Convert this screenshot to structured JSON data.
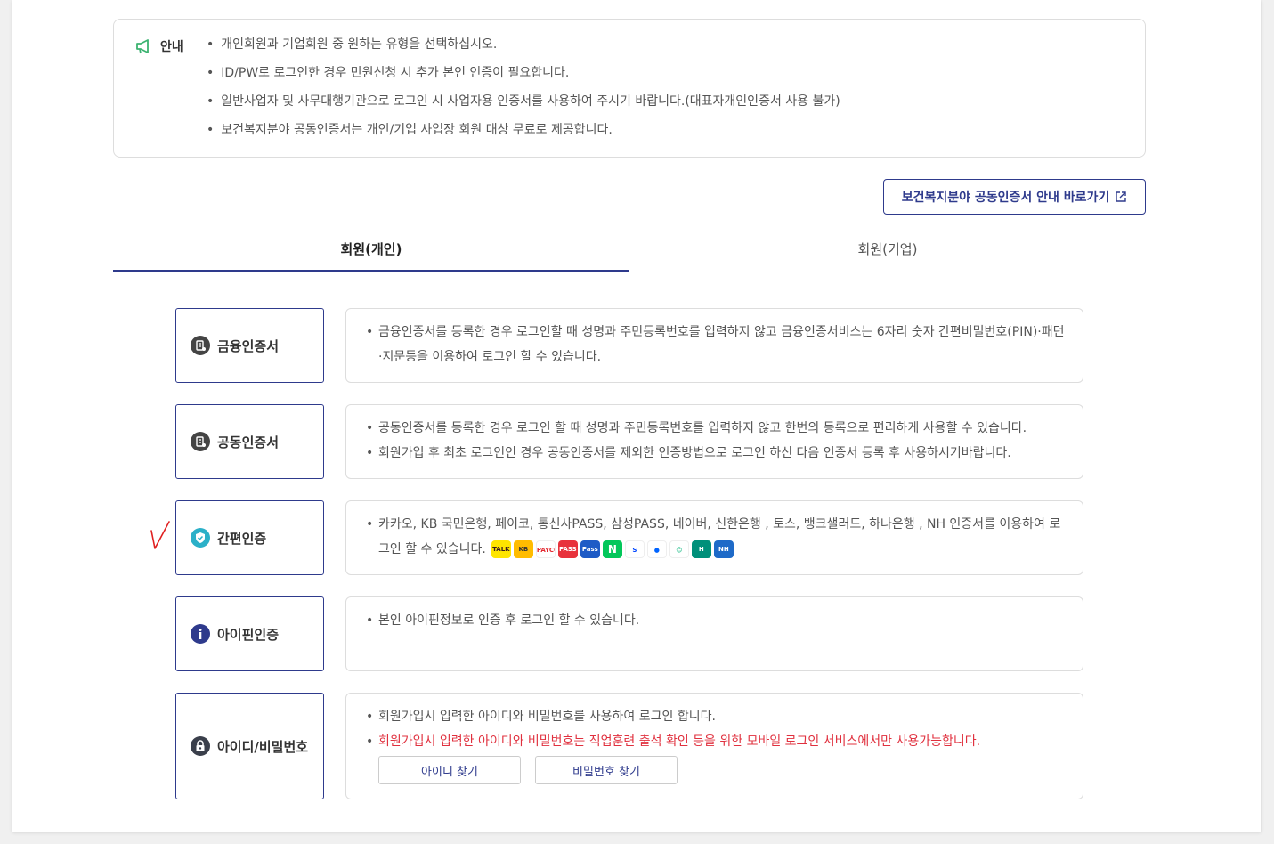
{
  "notice": {
    "label": "안내",
    "items": [
      "개인회원과 기업회원 중 원하는 유형을 선택하십시오.",
      "ID/PW로 로그인한 경우 민원신청 시 추가 본인 인증이 필요합니다.",
      "일반사업자 및 사무대행기관으로 로그인 시 사업자용 인증서를 사용하여 주시기 바랍니다.(대표자개인인증서 사용 불가)",
      "보건복지분야 공동인증서는 개인/기업 사업장 회원 대상 무료로 제공합니다."
    ]
  },
  "guide_button": "보건복지분야 공동인증서 안내 바로가기",
  "tabs": [
    {
      "label": "회원(개인)",
      "active": true
    },
    {
      "label": "회원(기업)",
      "active": false
    }
  ],
  "methods": {
    "finance": {
      "label": "금융인증서",
      "desc": [
        "금융인증서를 등록한 경우 로그인할 때 성명과 주민등록번호를 입력하지 않고 금융인증서비스는 6자리 숫자 간편비밀번호(PIN)·패턴·지문등을 이용하여 로그인 할 수 있습니다."
      ]
    },
    "joint": {
      "label": "공동인증서",
      "desc": [
        "공동인증서를 등록한 경우 로그인 할 때 성명과 주민등록번호를 입력하지 않고 한번의 등록으로 편리하게 사용할 수 있습니다.",
        "회원가입 후 최초 로그인인 경우 공동인증서를 제외한 인증방법으로 로그인 하신 다음 인증서 등록 후 사용하시기바랍니다."
      ]
    },
    "simple": {
      "label": "간편인증",
      "desc": "카카오, KB 국민은행, 페이코, 통신사PASS, 삼성PASS, 네이버, 신한은행 , 토스, 뱅크샐러드, 하나은행 , NH 인증서를 이용하여 로그인 할 수 있습니다."
    },
    "ipin": {
      "label": "아이핀인증",
      "desc": [
        "본인 아이핀정보로 인증 후 로그인 할 수 있습니다."
      ]
    },
    "idpw": {
      "label": "아이디/비밀번호",
      "desc": "회원가입시 입력한 아이디와 비밀번호를 사용하여 로그인 합니다.",
      "warn": "회원가입시 입력한 아이디와 비밀번호는 직업훈련 출석 확인 등을 위한 모바일 로그인 서비스에서만 사용가능합니다.",
      "find_id": "아이디 찾기",
      "find_pw": "비밀번호 찾기"
    }
  },
  "colors": {
    "accent": "#2e3a8c",
    "warn": "#e0303e",
    "notice_icon": "#3cb371",
    "simple_icon": "#2bb0c8"
  },
  "auth_icons": [
    "kakao-icon",
    "kb-icon",
    "payco-icon",
    "pass-icon",
    "samsung-pass-icon",
    "naver-icon",
    "shinhan-icon",
    "toss-icon",
    "banksalad-icon",
    "hana-icon",
    "nh-icon"
  ]
}
